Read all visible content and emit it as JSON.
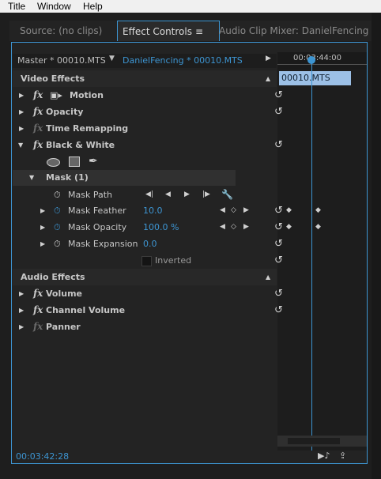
{
  "menu": [
    "Title",
    "Window",
    "Help"
  ],
  "tabs": {
    "source": "Source: (no clips)",
    "effect_controls": "Effect Controls",
    "panel_menu_icon": "≡",
    "audio_mixer": "Audio Clip Mixer: DanielFencing"
  },
  "header": {
    "master": "Master * 00010.MTS",
    "sequence": "DanielFencing * 00010.MTS",
    "timecode_ruler": "00:03:44:00",
    "clip_name": "00010.MTS"
  },
  "video_effects": {
    "title": "Video Effects",
    "items": [
      {
        "name": "Motion"
      },
      {
        "name": "Opacity"
      },
      {
        "name": "Time Remapping"
      },
      {
        "name": "Black & White"
      }
    ]
  },
  "mask": {
    "title": "Mask (1)",
    "path": "Mask Path",
    "feather": {
      "label": "Mask Feather",
      "value": "10.0"
    },
    "opacity": {
      "label": "Mask Opacity",
      "value": "100.0 %"
    },
    "expansion": {
      "label": "Mask Expansion",
      "value": "0.0"
    },
    "inverted": "Inverted"
  },
  "audio_effects": {
    "title": "Audio Effects",
    "items": [
      {
        "name": "Volume"
      },
      {
        "name": "Channel Volume"
      },
      {
        "name": "Panner"
      }
    ]
  },
  "footer": {
    "timecode": "00:03:42:28"
  },
  "colors": {
    "accent": "#3d95d2",
    "panel_bg": "#232323",
    "timeline_bg": "#1d1d1d"
  }
}
